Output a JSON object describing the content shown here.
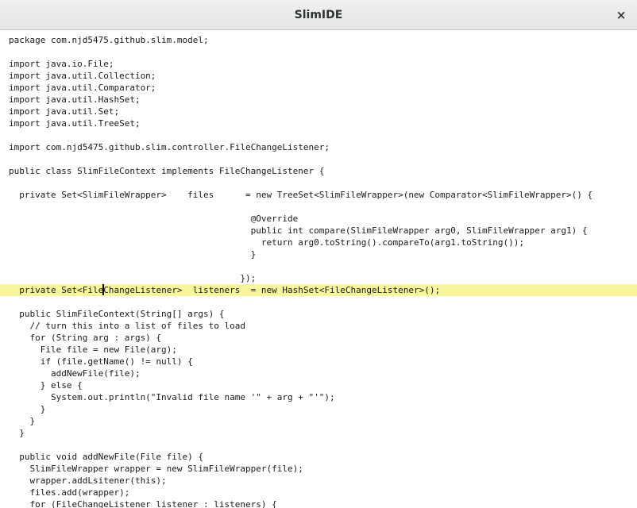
{
  "window": {
    "title": "SlimIDE",
    "close_glyph": "×",
    "close_icon": "close-icon"
  },
  "editor": {
    "current_line_color": "#f8f59a",
    "current_line_index": 21,
    "caret": {
      "line": 21,
      "before": "  private Set<File",
      "after": "hangeListener>  listeners  = new HashSet<FileChangeListener>();",
      "hidden_char": "C"
    },
    "lines": [
      "package com.njd5475.github.slim.model;",
      "",
      "import java.io.File;",
      "import java.util.Collection;",
      "import java.util.Comparator;",
      "import java.util.HashSet;",
      "import java.util.Set;",
      "import java.util.TreeSet;",
      "",
      "import com.njd5475.github.slim.controller.FileChangeListener;",
      "",
      "public class SlimFileContext implements FileChangeListener {",
      "",
      "  private Set<SlimFileWrapper>    files      = new TreeSet<SlimFileWrapper>(new Comparator<SlimFileWrapper>() {",
      "",
      "                                              @Override",
      "                                              public int compare(SlimFileWrapper arg0, SlimFileWrapper arg1) {",
      "                                                return arg0.toString().compareTo(arg1.toString());",
      "                                              }",
      "",
      "                                            });",
      "  private Set<FileChangeListener>  listeners  = new HashSet<FileChangeListener>();",
      "",
      "  public SlimFileContext(String[] args) {",
      "    // turn this into a list of files to load",
      "    for (String arg : args) {",
      "      File file = new File(arg);",
      "      if (file.getName() != null) {",
      "        addNewFile(file);",
      "      } else {",
      "        System.out.println(\"Invalid file name '\" + arg + \"'\");",
      "      }",
      "    }",
      "  }",
      "",
      "  public void addNewFile(File file) {",
      "    SlimFileWrapper wrapper = new SlimFileWrapper(file);",
      "    wrapper.addLsitener(this);",
      "    files.add(wrapper);",
      "    for (FileChangeListener listener : listeners) {"
    ]
  }
}
